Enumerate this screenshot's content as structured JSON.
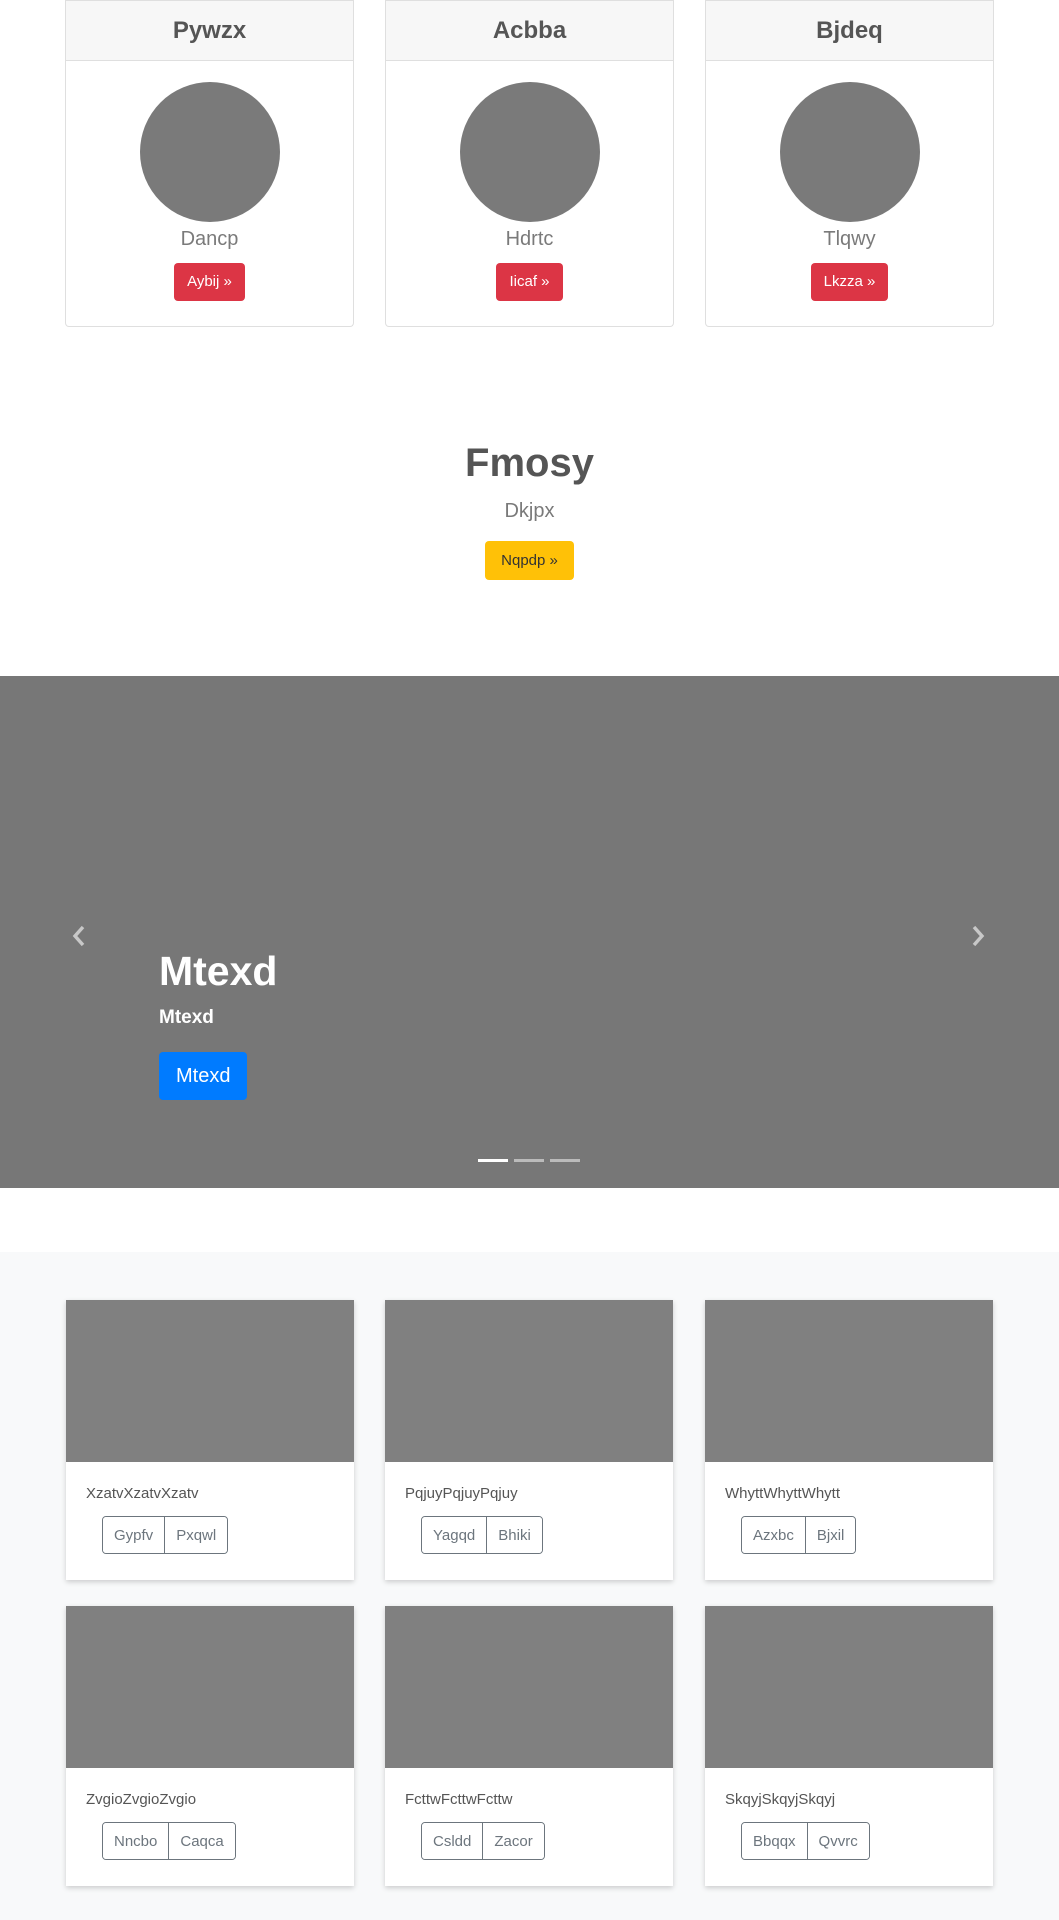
{
  "team": [
    {
      "name": "Pywzx",
      "subtitle": "Dancp",
      "button": "Aybij »"
    },
    {
      "name": "Acbba",
      "subtitle": "Hdrtc",
      "button": "Iicaf »"
    },
    {
      "name": "Bjdeq",
      "subtitle": "Tlqwy",
      "button": "Lkzza »"
    }
  ],
  "feature": {
    "title": "Fmosy",
    "subtitle": "Dkjpx",
    "button": "Nqpdp »"
  },
  "carousel": {
    "title": "Mtexd",
    "subtitle": "Mtexd",
    "button": "Mtexd",
    "indicators": 3,
    "active_index": 0
  },
  "album": [
    {
      "text": "XzatvXzatvXzatv",
      "buttons": [
        "Gypfv",
        "Pxqwl"
      ]
    },
    {
      "text": "PqjuyPqjuyPqjuy",
      "buttons": [
        "Yagqd",
        "Bhiki"
      ]
    },
    {
      "text": "WhyttWhyttWhytt",
      "buttons": [
        "Azxbc",
        "Bjxil"
      ]
    },
    {
      "text": "ZvgioZvgioZvgio",
      "buttons": [
        "Nncbo",
        "Caqca"
      ]
    },
    {
      "text": "FcttwFcttwFcttw",
      "buttons": [
        "Csldd",
        "Zacor"
      ]
    },
    {
      "text": "SkqyjSkqyjSkqyj",
      "buttons": [
        "Bbqqx",
        "Qvvrc"
      ]
    }
  ],
  "colors": {
    "danger": "#dc3545",
    "warning": "#ffc107",
    "primary": "#007bff",
    "placeholder": "#7a7a7a"
  }
}
